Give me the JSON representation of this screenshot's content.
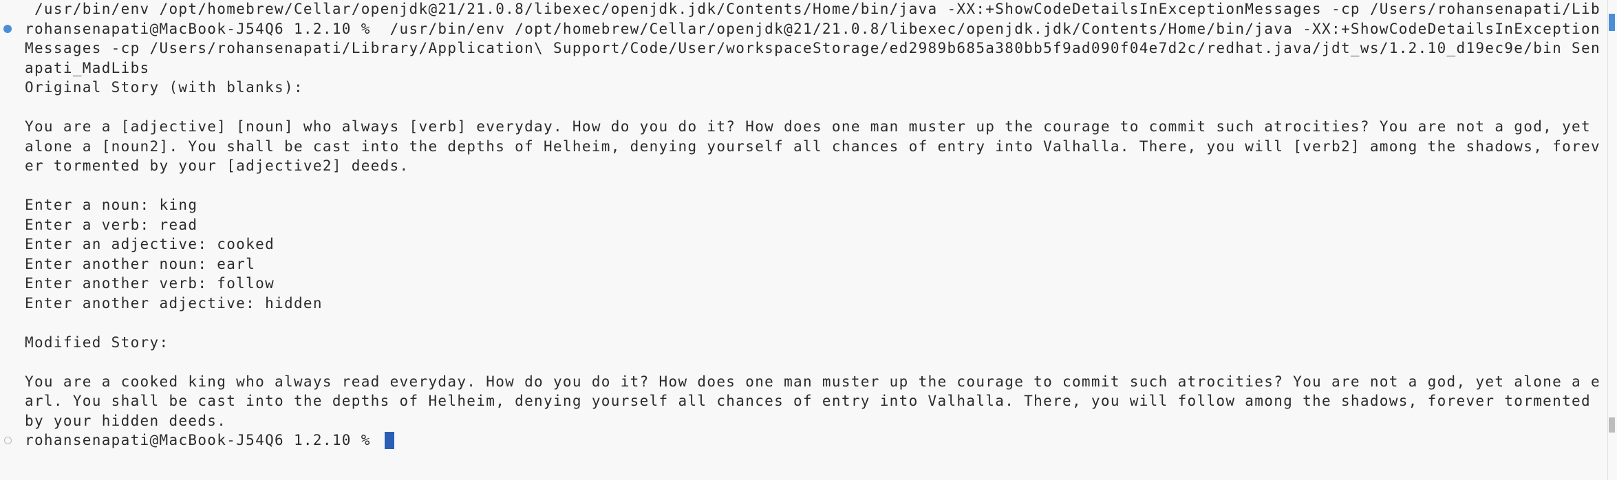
{
  "terminal": {
    "lines": [
      " /usr/bin/env /opt/homebrew/Cellar/openjdk@21/21.0.8/libexec/openjdk.jdk/Contents/Home/bin/java -XX:+ShowCodeDetailsInExceptionMessages -cp /Users/rohansenapati/Lib",
      "rohansenapati@MacBook-J54Q6 1.2.10 %  /usr/bin/env /opt/homebrew/Cellar/openjdk@21/21.0.8/libexec/openjdk.jdk/Contents/Home/bin/java -XX:+ShowCodeDetailsInException",
      "Messages -cp /Users/rohansenapati/Library/Application\\ Support/Code/User/workspaceStorage/ed2989b685a380bb5f9ad090f04e7d2c/redhat.java/jdt_ws/1.2.10_d19ec9e/bin Sen",
      "apati_MadLibs",
      "Original Story (with blanks):",
      "",
      "You are a [adjective] [noun] who always [verb] everyday. How do you do it? How does one man muster up the courage to commit such atrocities? You are not a god, yet ",
      "alone a [noun2]. You shall be cast into the depths of Helheim, denying yourself all chances of entry into Valhalla. There, you will [verb2] among the shadows, forev",
      "er tormented by your [adjective2] deeds.",
      "",
      "Enter a noun: king",
      "Enter a verb: read",
      "Enter an adjective: cooked",
      "Enter another noun: earl",
      "Enter another verb: follow",
      "Enter another adjective: hidden",
      "",
      "Modified Story:",
      "",
      "You are a cooked king who always read everyday. How do you do it? How does one man muster up the courage to commit such atrocities? You are not a god, yet alone a e",
      "arl. You shall be cast into the depths of Helheim, denying yourself all chances of entry into Valhalla. There, you will follow among the shadows, forever tormented ",
      "by your hidden deeds.",
      "rohansenapati@MacBook-J54Q6 1.2.10 % "
    ],
    "colors": {
      "background": "#f8f8f8",
      "text": "#2b2b2b",
      "command_marker": "#4a8fd6",
      "cursor": "#2b5fb5"
    },
    "icons": {
      "completed_command_marker": "filled-circle-icon",
      "current_prompt_marker": "hollow-circle-icon"
    }
  }
}
